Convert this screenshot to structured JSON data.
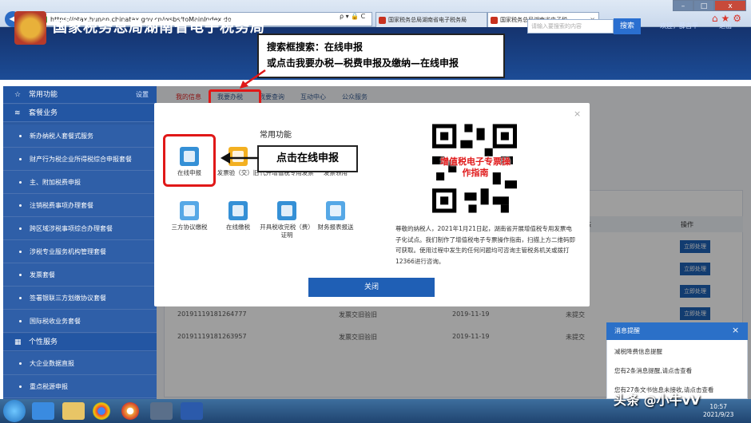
{
  "browser": {
    "url": "https://etax.hunan.chinatax.gov.cn/wsbs/toMainIndex.do",
    "addr_tools": "ρ ▾ 🔒 C",
    "tabs": [
      {
        "label": "国家税务总局湖南省电子税务局"
      },
      {
        "label": "国家税务总局湖南省电子税..."
      }
    ],
    "window_controls": [
      "–",
      "□",
      "x"
    ]
  },
  "header": {
    "site_title": "国家税务总局湖南省电子税务局",
    "search_placeholder": "请输入要搜索的内容",
    "search_button": "搜索",
    "welcome": "欢迎，薛吉平",
    "logout": "退出"
  },
  "annotations": {
    "top_line1": "搜索框搜索：在线申报",
    "top_line2": "或点击我要办税—税费申报及缴纳—在线申报",
    "mid": "点击在线申报"
  },
  "sidebar": {
    "common_label": "常用功能",
    "settings_label": "设置",
    "package_label": "套餐业务",
    "personal_label": "个性服务",
    "items": [
      "新办纳税人套餐式服务",
      "财产行为税企业所得税综合申报套餐",
      "主、附加税费申报",
      "注销税费事项办理套餐",
      "跨区域涉税事项综合办理套餐",
      "涉税专业服务机构管理套餐",
      "发票套餐",
      "签署银联三方划缴协议套餐",
      "国际税收业务套餐",
      "大企业数据直报",
      "重点税源申报"
    ]
  },
  "menu_tabs": [
    "我的信息",
    "我要办税",
    "我要查询",
    "互动中心",
    "公众服务"
  ],
  "table": {
    "op_header": "操作",
    "status_header_fragment": "态",
    "op_button": "立即处理",
    "rows": [
      {
        "id": "20191119181264777",
        "type": "发票交旧验旧",
        "date": "2019-11-19",
        "status": "未提交"
      },
      {
        "id": "20191119181263957",
        "type": "发票交旧验旧",
        "date": "2019-11-19",
        "status": "未提交"
      }
    ]
  },
  "modal": {
    "section_title": "常用功能",
    "close_x": "×",
    "functions": [
      {
        "label": "在线申报",
        "icon": "online-declare-icon"
      },
      {
        "label": "发票验（交）旧",
        "icon": "invoice-verify-icon"
      },
      {
        "label": "代开增值税专用发票",
        "icon": "vat-invoice-icon"
      },
      {
        "label": "发票领用",
        "icon": "invoice-collect-icon"
      },
      {
        "label": "三方协议缴税",
        "icon": "tripartite-agreement-icon"
      },
      {
        "label": "在线缴税",
        "icon": "online-payment-icon"
      },
      {
        "label": "开具税收完税（费）证明",
        "icon": "tax-certificate-icon"
      },
      {
        "label": "财务报表报送",
        "icon": "financial-report-icon"
      }
    ],
    "qr_caption": "增值税电子专票操作指南",
    "notice": "尊敬的纳税人，2021年1月21日起，湖南省开展增值税专用发票电子化试点。我们制作了增值税电子专票操作指南，扫描上方二维码即可获取。使用过程中发生的任何问题均可咨询主管税务机关或拨打12366进行咨询。",
    "close_button": "关闭"
  },
  "notification": {
    "title": "消息提醒",
    "close_x": "×",
    "lines": [
      "减税降费信息提醒",
      "您有2条消息提醒,请点击查看",
      "您有27条文书信息未接收,请点击查看"
    ]
  },
  "taskbar": {
    "watermark": "头条 @小牛vV",
    "time": "10:57",
    "date": "2021/9/23"
  }
}
